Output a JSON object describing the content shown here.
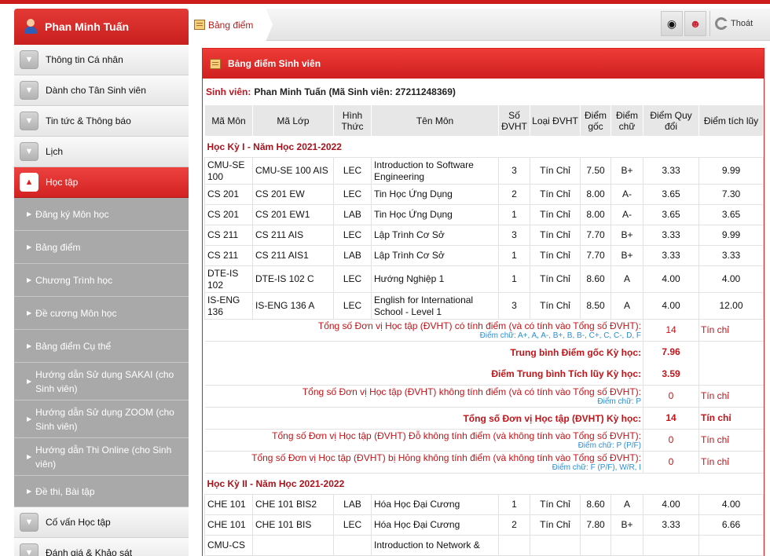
{
  "sidebar": {
    "user_name": "Phan Minh Tuấn",
    "items_top": [
      {
        "label": "Thông tin Cá nhân"
      },
      {
        "label": "Dành cho Tân Sinh viên"
      },
      {
        "label": "Tin tức & Thông báo"
      },
      {
        "label": "Lịch"
      }
    ],
    "active_item": {
      "label": "Học tập"
    },
    "sub_items": [
      {
        "label": "Đăng ký Môn học"
      },
      {
        "label": "Bảng điểm"
      },
      {
        "label": "Chương Trình học"
      },
      {
        "label": "Đề cương Môn học"
      },
      {
        "label": "Bảng điểm Cụ thể"
      },
      {
        "label": "Hướng dẫn Sử dụng SAKAI (cho Sinh viên)"
      },
      {
        "label": "Hướng dẫn Sử dụng ZOOM (cho Sinh viên)"
      },
      {
        "label": "Hướng dẫn Thi Online (cho Sinh viên)"
      },
      {
        "label": "Đề thi, Bài tập"
      }
    ],
    "items_bottom": [
      {
        "label": "Cố vấn Học tập"
      },
      {
        "label": "Đánh giá & Khảo sát"
      }
    ]
  },
  "topbar": {
    "breadcrumb": "Bảng điểm",
    "logout_label": "Thoát"
  },
  "panel": {
    "title": "Bảng điểm Sinh viên",
    "student_label": "Sinh viên:",
    "student_value": "Phan Minh Tuấn (Mã Sinh viên: 27211248369)"
  },
  "table": {
    "headers": [
      "Mã Môn",
      "Mã Lớp",
      "Hình Thức",
      "Tên Môn",
      "Số ĐVHT",
      "Loại ĐVHT",
      "Điểm gốc",
      "Điểm chữ",
      "Điểm Quy đổi",
      "Điểm tích lũy"
    ],
    "semester1": {
      "title": "Học Kỳ I - Năm Học 2021-2022",
      "rows": [
        [
          "CMU-SE 100",
          "CMU-SE 100 AIS",
          "LEC",
          "Introduction to Software Engineering",
          "3",
          "Tín Chỉ",
          "7.50",
          "B+",
          "3.33",
          "9.99"
        ],
        [
          "CS 201",
          "CS 201 EW",
          "LEC",
          "Tin Học Ứng Dụng",
          "2",
          "Tín Chỉ",
          "8.00",
          "A-",
          "3.65",
          "7.30"
        ],
        [
          "CS 201",
          "CS 201 EW1",
          "LAB",
          "Tin Học Ứng Dụng",
          "1",
          "Tín Chỉ",
          "8.00",
          "A-",
          "3.65",
          "3.65"
        ],
        [
          "CS 211",
          "CS 211 AIS",
          "LEC",
          "Lập Trình Cơ Sở",
          "3",
          "Tín Chỉ",
          "7.70",
          "B+",
          "3.33",
          "9.99"
        ],
        [
          "CS 211",
          "CS 211 AIS1",
          "LAB",
          "Lập Trình Cơ Sở",
          "1",
          "Tín Chỉ",
          "7.70",
          "B+",
          "3.33",
          "3.33"
        ],
        [
          "DTE-IS 102",
          "DTE-IS 102 C",
          "LEC",
          "Hướng Nghiệp 1",
          "1",
          "Tín Chỉ",
          "8.60",
          "A",
          "4.00",
          "4.00"
        ],
        [
          "IS-ENG 136",
          "IS-ENG 136 A",
          "LEC",
          "English for International School - Level 1",
          "3",
          "Tín Chỉ",
          "8.50",
          "A",
          "4.00",
          "12.00"
        ]
      ],
      "summary": {
        "total_graded_label": "Tổng số Đơn vị Học tập (ĐVHT) có tính điểm (và có tính vào Tổng số ĐVHT):",
        "total_graded_note": "Điểm chữ: A+, A, A-, B+, B, B-, C+, C, C-, D, F",
        "total_graded_value": "14",
        "total_graded_unit": "Tín chỉ",
        "avg_raw_label": "Trung bình Điểm gốc Kỳ học:",
        "avg_raw_value": "7.96",
        "avg_cum_label": "Điểm Trung bình Tích lũy Kỳ học:",
        "avg_cum_value": "3.59",
        "total_ungraded_label": "Tổng số Đơn vị Học tập (ĐVHT) không tính điểm (và có tính vào Tổng số ĐVHT):",
        "total_ungraded_note": "Điểm chữ: P",
        "total_ungraded_value": "0",
        "total_ungraded_unit": "Tín chỉ",
        "total_sem_label": "Tổng số Đơn vị Học tập (ĐVHT) Kỳ học:",
        "total_sem_value": "14",
        "total_sem_unit": "Tín chỉ",
        "total_pass_label": "Tổng số Đơn vị Học tập (ĐVHT) Đỗ không tính điểm (và không tính vào Tổng số ĐVHT):",
        "total_pass_note": "Điểm chữ: P (P/F)",
        "total_pass_value": "0",
        "total_pass_unit": "Tín chỉ",
        "total_fail_label": "Tổng số Đơn vị Học tập (ĐVHT) bị Hỏng không tính điểm (và không tính vào Tổng số ĐVHT):",
        "total_fail_note": "Điểm chữ: F (P/F), W/R, I",
        "total_fail_value": "0",
        "total_fail_unit": "Tín chỉ"
      }
    },
    "semester2": {
      "title": "Học Kỳ II - Năm Học 2021-2022",
      "rows": [
        [
          "CHE 101",
          "CHE 101 BIS2",
          "LAB",
          "Hóa Học Đại Cương",
          "1",
          "Tín Chỉ",
          "8.60",
          "A",
          "4.00",
          "4.00"
        ],
        [
          "CHE 101",
          "CHE 101 BIS",
          "LEC",
          "Hóa Học Đại Cương",
          "2",
          "Tín Chỉ",
          "7.80",
          "B+",
          "3.33",
          "6.66"
        ],
        [
          "CMU-CS",
          "",
          "",
          "Introduction to Network &",
          "",
          "",
          "",
          "",
          "",
          ""
        ]
      ]
    }
  }
}
